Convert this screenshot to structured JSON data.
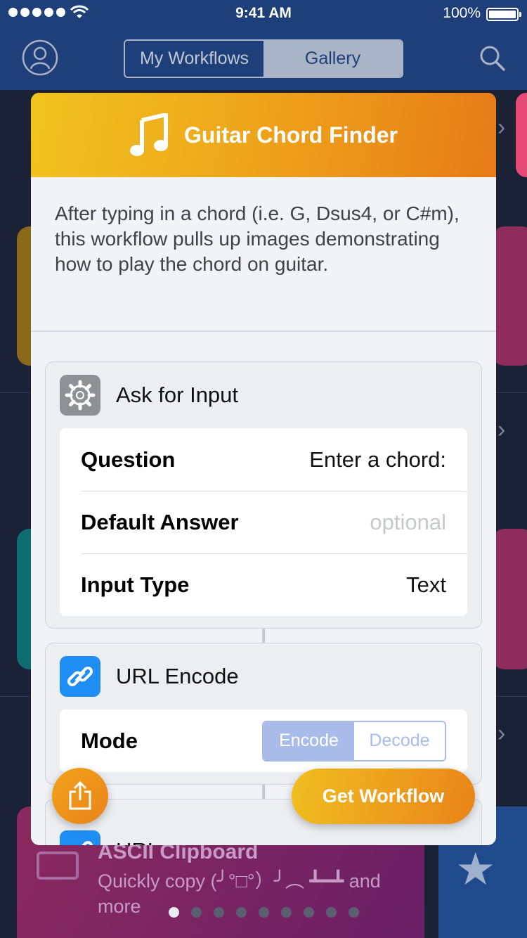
{
  "status_bar": {
    "time": "9:41 AM",
    "battery": "100%"
  },
  "nav": {
    "tabs": [
      "My Workflows",
      "Gallery"
    ],
    "selected_tab": "Gallery"
  },
  "modal": {
    "title": "Guitar Chord Finder",
    "icon": "music-note-icon",
    "description": "After typing in a chord (i.e. G, Dsus4, or C#m), this workflow pulls up images demonstrating how to play the chord on guitar.",
    "actions": [
      {
        "name": "Ask for Input",
        "icon": "gear-icon",
        "rows": [
          {
            "label": "Question",
            "value": "Enter a chord:"
          },
          {
            "label": "Default Answer",
            "placeholder": "optional"
          },
          {
            "label": "Input Type",
            "value": "Text"
          }
        ]
      },
      {
        "name": "URL Encode",
        "icon": "link-icon",
        "mode": {
          "label": "Mode",
          "options": [
            "Encode",
            "Decode"
          ],
          "selected": "Encode"
        }
      },
      {
        "name": "URL",
        "icon": "link-icon"
      }
    ],
    "get_button": "Get Workflow"
  },
  "background": {
    "ascii_card": {
      "title": "ASCII Clipboard",
      "description": "Quickly copy (╯°□°）╯︵ ┻━┻ and more"
    },
    "page_dots": {
      "count": 9,
      "active": 1
    }
  },
  "colors": {
    "nav_bar": "#1f3f7a",
    "header_gradient_start": "#f0c41f",
    "header_gradient_end": "#e57b18",
    "accent_blue": "#1e8ef5"
  }
}
